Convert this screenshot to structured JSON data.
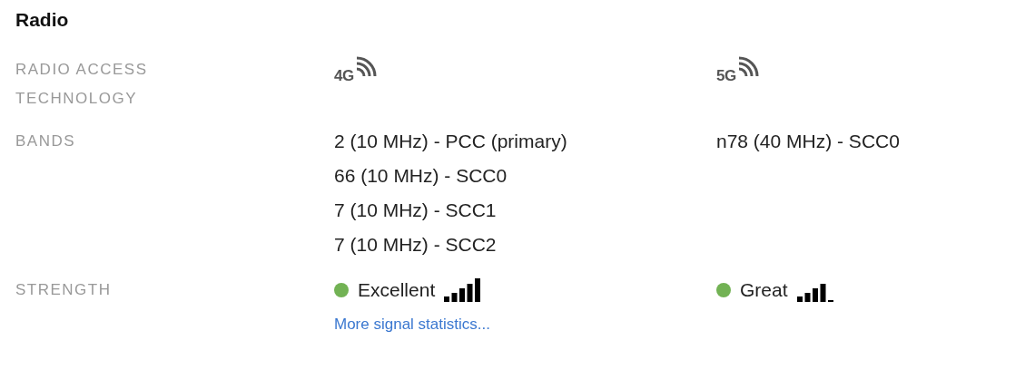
{
  "title": "Radio",
  "rows": [
    {
      "kind": "tech",
      "label": "RADIO ACCESS TECHNOLOGY",
      "values": [
        {
          "icon_text": "4G"
        },
        {
          "icon_text": "5G"
        }
      ]
    },
    {
      "kind": "bands",
      "label": "BANDS",
      "values": [
        {
          "lines": [
            "2 (10 MHz) - PCC (primary)",
            "66 (10 MHz) - SCC0",
            "7 (10 MHz) - SCC1",
            "7 (10 MHz) - SCC2"
          ]
        },
        {
          "lines": [
            "n78 (40 MHz) - SCC0"
          ]
        }
      ]
    },
    {
      "kind": "strength",
      "label": "STRENGTH",
      "values": [
        {
          "text": "Excellent",
          "color": "#72b254",
          "kind": "excellent",
          "link": "More signal statistics..."
        },
        {
          "text": "Great",
          "color": "#72b254",
          "kind": "great"
        }
      ]
    }
  ]
}
